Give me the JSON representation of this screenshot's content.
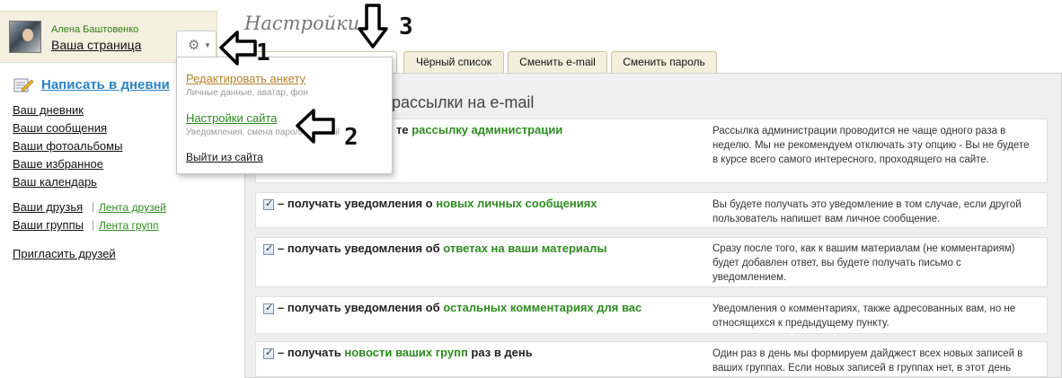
{
  "user": {
    "name": "Алена Баштовенко",
    "page_link": "Ваша страница"
  },
  "sidebar": {
    "write_diary": "Написать в дневни",
    "links": [
      "Ваш дневник",
      "Ваши сообщения",
      "Ваши фотоальбомы",
      "Ваше избранное",
      "Ваш календарь"
    ],
    "friends": {
      "label": "Ваши друзья",
      "sub": "Лента друзей"
    },
    "groups": {
      "label": "Ваши группы",
      "sub": "Лента групп"
    },
    "invite": "Пригласить друзей"
  },
  "dropdown": {
    "edit_profile": "Редактировать анкету",
    "edit_profile_desc": "Личные данные, аватар, фон",
    "site_settings": "Настройки сайта",
    "site_settings_desc": "Уведомления, смена пароля и e-mail",
    "logout": "Выйти из сайта"
  },
  "page": {
    "title": "Настройки",
    "section_title": "рассылки на e-mail"
  },
  "tabs": [
    "Чёрный список",
    "Сменить e-mail",
    "Сменить пароль"
  ],
  "options": [
    {
      "label_pre": "те ",
      "label_hl": "рассылку администрации",
      "label_post": "",
      "desc": "Рассылка администрации проводится не чаще одного раза в неделю. Мы не рекомендуем отключать эту опцию - Вы не будете в курсе всего самого интересного, проходящего на сайте."
    },
    {
      "label_pre": "– получать уведомления о ",
      "label_hl": "новых личных сообщениях",
      "label_post": "",
      "desc": "Вы будете получать это уведомление в том случае, если другой пользователь напишет вам личное сообщение."
    },
    {
      "label_pre": "– получать уведомления об ",
      "label_hl": "ответах на ваши материалы",
      "label_post": "",
      "desc": "Сразу после того, как к вашим материалам (не комментариям) будет добавлен ответ, вы будете получать письмо с уведомлением."
    },
    {
      "label_pre": "– получать уведомления об ",
      "label_hl": "остальных комментариях для вас",
      "label_post": "",
      "desc": "Уведомления о комментариях, также адресованных вам, но не относящихся к предыдущему пункту."
    },
    {
      "label_pre": "– получать ",
      "label_hl": "новости ваших групп",
      "label_post": " раз в день",
      "desc": "Один раз в день мы формируем дайджест всех новых записей в ваших группах. Если новых записей в группах нет, в этот день"
    }
  ],
  "annotations": [
    "1",
    "2",
    "3"
  ],
  "icons": {
    "gear": "gear-icon",
    "pencil": "pencil-icon",
    "checkbox": "checkbox-checked-icon"
  },
  "colors": {
    "accent_green": "#2e8b20",
    "link_blue": "#2a83c5",
    "header_bg": "#f5efe0"
  }
}
